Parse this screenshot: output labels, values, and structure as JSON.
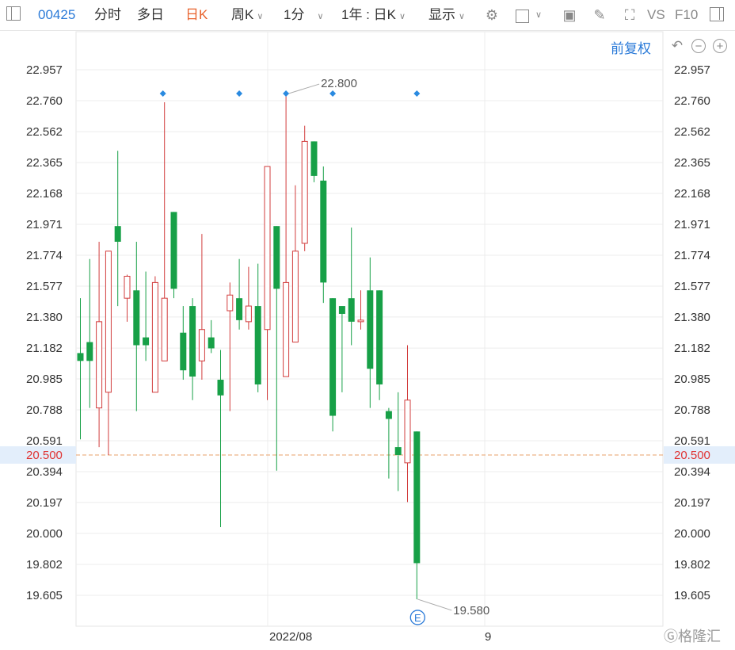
{
  "toolbar": {
    "code": "00425",
    "tabs": [
      "分时",
      "多日",
      "日K",
      "周K",
      "1分",
      "1年 : 日K",
      "显示"
    ],
    "active_tab": "日K",
    "vs_label": "VS",
    "f10_label": "F10",
    "adjust_label": "前复权"
  },
  "icons": [
    "sidebar-icon",
    "gear-icon",
    "square-icon",
    "camera-icon",
    "pen-icon",
    "fullscreen-icon",
    "panel-icon",
    "undo-icon",
    "zoom-out-icon",
    "zoom-in-icon"
  ],
  "colors": {
    "up": "#d23c3c",
    "down": "#17a047",
    "current_line": "#e8a06a",
    "current_label": "#e03333",
    "accent": "#2a7ad8"
  },
  "chart_data": {
    "type": "candlestick",
    "y_ticks": [
      "22.957",
      "22.760",
      "22.562",
      "22.365",
      "22.168",
      "21.971",
      "21.774",
      "21.577",
      "21.380",
      "21.182",
      "20.985",
      "20.788",
      "20.591",
      "20.394",
      "20.197",
      "20.000",
      "19.802",
      "19.605"
    ],
    "ylim": [
      19.5,
      23.05
    ],
    "x_labels": [
      "2022/08",
      "9"
    ],
    "current_price": "20.500",
    "high_annotation": "22.800",
    "low_annotation": "19.580",
    "event_marker": "E",
    "candles": [
      {
        "o": 21.15,
        "h": 21.5,
        "l": 20.6,
        "c": 21.1
      },
      {
        "o": 21.22,
        "h": 21.75,
        "l": 20.8,
        "c": 21.1
      },
      {
        "o": 20.8,
        "h": 21.86,
        "l": 20.55,
        "c": 21.35
      },
      {
        "o": 20.9,
        "h": 21.8,
        "l": 20.5,
        "c": 21.8
      },
      {
        "o": 21.96,
        "h": 22.44,
        "l": 21.45,
        "c": 21.86
      },
      {
        "o": 21.5,
        "h": 21.65,
        "l": 21.35,
        "c": 21.64
      },
      {
        "o": 21.55,
        "h": 21.86,
        "l": 20.78,
        "c": 21.2
      },
      {
        "o": 21.25,
        "h": 21.67,
        "l": 21.1,
        "c": 21.2
      },
      {
        "o": 20.9,
        "h": 21.64,
        "l": 20.9,
        "c": 21.6
      },
      {
        "o": 21.1,
        "h": 22.75,
        "l": 21.1,
        "c": 21.5
      },
      {
        "o": 22.05,
        "h": 22.05,
        "l": 21.5,
        "c": 21.56
      },
      {
        "o": 21.28,
        "h": 21.45,
        "l": 20.98,
        "c": 21.04
      },
      {
        "o": 21.45,
        "h": 21.5,
        "l": 20.85,
        "c": 21.0
      },
      {
        "o": 21.1,
        "h": 21.91,
        "l": 20.98,
        "c": 21.3
      },
      {
        "o": 21.25,
        "h": 21.36,
        "l": 21.15,
        "c": 21.18
      },
      {
        "o": 20.98,
        "h": 21.17,
        "l": 20.04,
        "c": 20.88
      },
      {
        "o": 21.42,
        "h": 21.6,
        "l": 20.78,
        "c": 21.52
      },
      {
        "o": 21.5,
        "h": 21.75,
        "l": 21.3,
        "c": 21.36
      },
      {
        "o": 21.35,
        "h": 21.7,
        "l": 21.3,
        "c": 21.45
      },
      {
        "o": 21.45,
        "h": 21.72,
        "l": 20.9,
        "c": 20.95
      },
      {
        "o": 21.3,
        "h": 22.34,
        "l": 20.85,
        "c": 22.34
      },
      {
        "o": 21.96,
        "h": 21.96,
        "l": 20.4,
        "c": 21.56
      },
      {
        "o": 21.0,
        "h": 22.8,
        "l": 21.0,
        "c": 21.6
      },
      {
        "o": 21.22,
        "h": 22.22,
        "l": 21.22,
        "c": 21.8
      },
      {
        "o": 21.85,
        "h": 22.6,
        "l": 21.8,
        "c": 22.5
      },
      {
        "o": 22.5,
        "h": 22.5,
        "l": 22.24,
        "c": 22.28
      },
      {
        "o": 22.25,
        "h": 22.34,
        "l": 21.47,
        "c": 21.6
      },
      {
        "o": 21.5,
        "h": 21.5,
        "l": 20.65,
        "c": 20.75
      },
      {
        "o": 21.45,
        "h": 21.45,
        "l": 20.9,
        "c": 21.4
      },
      {
        "o": 21.5,
        "h": 21.95,
        "l": 21.2,
        "c": 21.35
      },
      {
        "o": 21.35,
        "h": 21.55,
        "l": 21.3,
        "c": 21.36
      },
      {
        "o": 21.55,
        "h": 21.76,
        "l": 20.8,
        "c": 21.05
      },
      {
        "o": 21.55,
        "h": 21.55,
        "l": 20.85,
        "c": 20.95
      },
      {
        "o": 20.78,
        "h": 20.8,
        "l": 20.35,
        "c": 20.73
      },
      {
        "o": 20.55,
        "h": 20.9,
        "l": 20.27,
        "c": 20.5
      },
      {
        "o": 20.45,
        "h": 21.2,
        "l": 20.2,
        "c": 20.85
      },
      {
        "o": 20.65,
        "h": 20.65,
        "l": 19.58,
        "c": 19.81
      }
    ]
  }
}
